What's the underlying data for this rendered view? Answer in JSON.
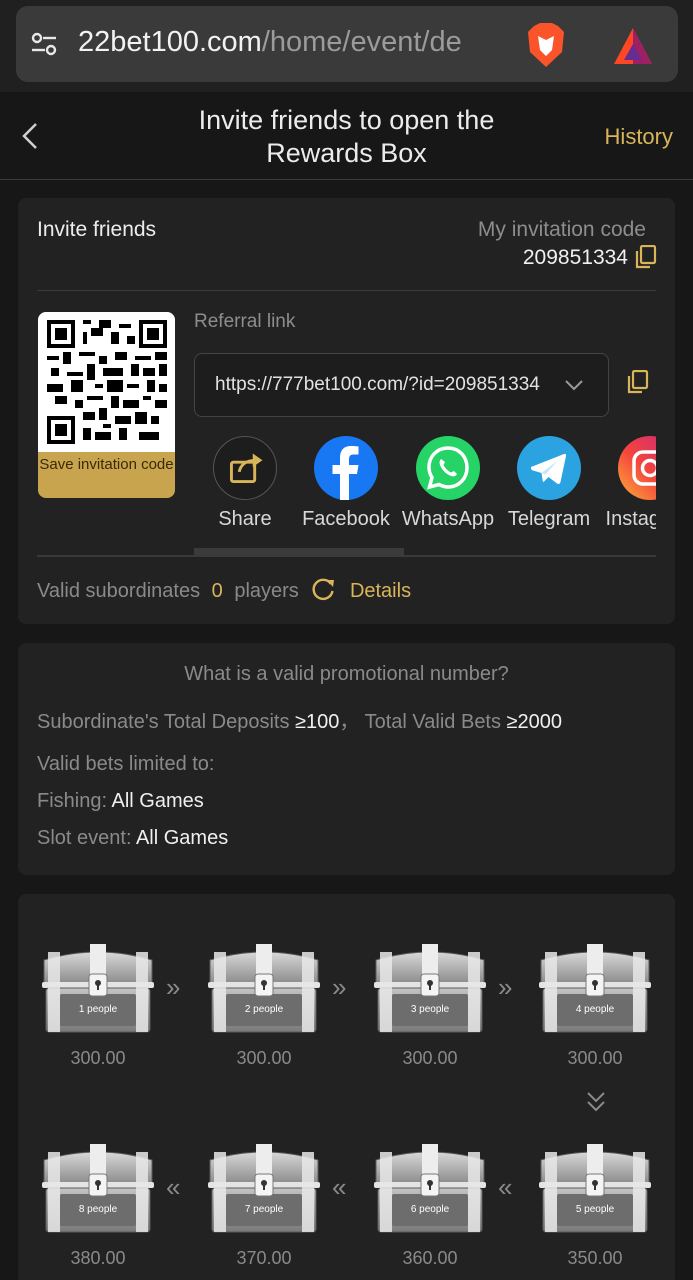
{
  "browser": {
    "domain": "22bet100.com",
    "path": "/home/event/de"
  },
  "header": {
    "title": "Invite friends to open the Rewards Box",
    "history": "History"
  },
  "invite": {
    "title": "Invite friends",
    "code_label": "My invitation code",
    "code_value": "209851334",
    "qr_caption": "Save invitation code",
    "referral_label": "Referral link",
    "referral_value": "https://777bet100.com/?id=209851334"
  },
  "share": [
    {
      "label": "Share",
      "icon": "share-icon"
    },
    {
      "label": "Facebook",
      "icon": "facebook-icon"
    },
    {
      "label": "WhatsApp",
      "icon": "whatsapp-icon"
    },
    {
      "label": "Telegram",
      "icon": "telegram-icon"
    },
    {
      "label": "Instagram",
      "icon": "instagram-icon"
    }
  ],
  "valid": {
    "label": "Valid subordinates",
    "count": "0",
    "unit": "players",
    "details": "Details"
  },
  "rules": {
    "question": "What is a valid promotional number?",
    "deposits_label": "Subordinate's Total Deposits",
    "deposits_value": "≥100",
    "sep": "，",
    "bets_label": "Total Valid Bets",
    "bets_value": "≥2000",
    "limited": "Valid bets limited to:",
    "fishing_label": "Fishing:",
    "fishing_value": "All Games",
    "slot_label": "Slot event:",
    "slot_value": "All Games"
  },
  "chests": [
    {
      "label": "1 people",
      "amount": "300.00"
    },
    {
      "label": "2 people",
      "amount": "300.00"
    },
    {
      "label": "3 people",
      "amount": "300.00"
    },
    {
      "label": "4 people",
      "amount": "300.00"
    },
    {
      "label": "5 people",
      "amount": "350.00"
    },
    {
      "label": "6 people",
      "amount": "360.00"
    },
    {
      "label": "7 people",
      "amount": "370.00"
    },
    {
      "label": "8 people",
      "amount": "380.00"
    }
  ],
  "colors": {
    "accent": "#d9b55a",
    "background": "#171717",
    "card": "#222222"
  }
}
